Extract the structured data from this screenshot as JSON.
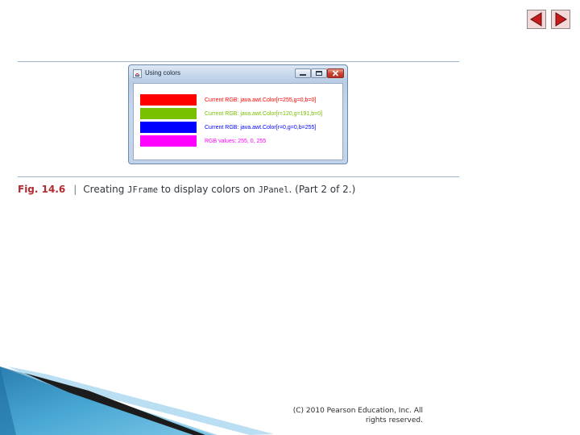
{
  "window": {
    "title": "Using colors",
    "rows": [
      {
        "swatch_color": "#ff0000",
        "text_color": "#ff0000",
        "text": "Current RGB: java.awt.Color[r=255,g=0,b=0]"
      },
      {
        "swatch_color": "#78c000",
        "text_color": "#78c000",
        "text": "Current RGB: java.awt.Color[r=120,g=191,b=0]"
      },
      {
        "swatch_color": "#0000ff",
        "text_color": "#0000ff",
        "text": "Current RGB: java.awt.Color[r=0,g=0,b=255]"
      },
      {
        "swatch_color": "#ff00ff",
        "text_color": "#ff00ff",
        "text": "RGB values: 255, 0, 255"
      }
    ]
  },
  "caption": {
    "fig_label": "Fig. 14.6",
    "part1": "Creating ",
    "code1": "JFrame",
    "part2": " to display colors on ",
    "code2": "JPanel",
    "part3": ". (Part 2 of 2.)"
  },
  "footer": {
    "copyright": "(C) 2010 Pearson Education, Inc.  All rights reserved."
  },
  "nav": {
    "prev_icon": "arrow-left-icon",
    "next_icon": "arrow-right-icon"
  },
  "colors": {
    "fig_label": "#b12a2f",
    "rule": "#9fb3c8",
    "nav_arrow": "#c41b1b"
  }
}
